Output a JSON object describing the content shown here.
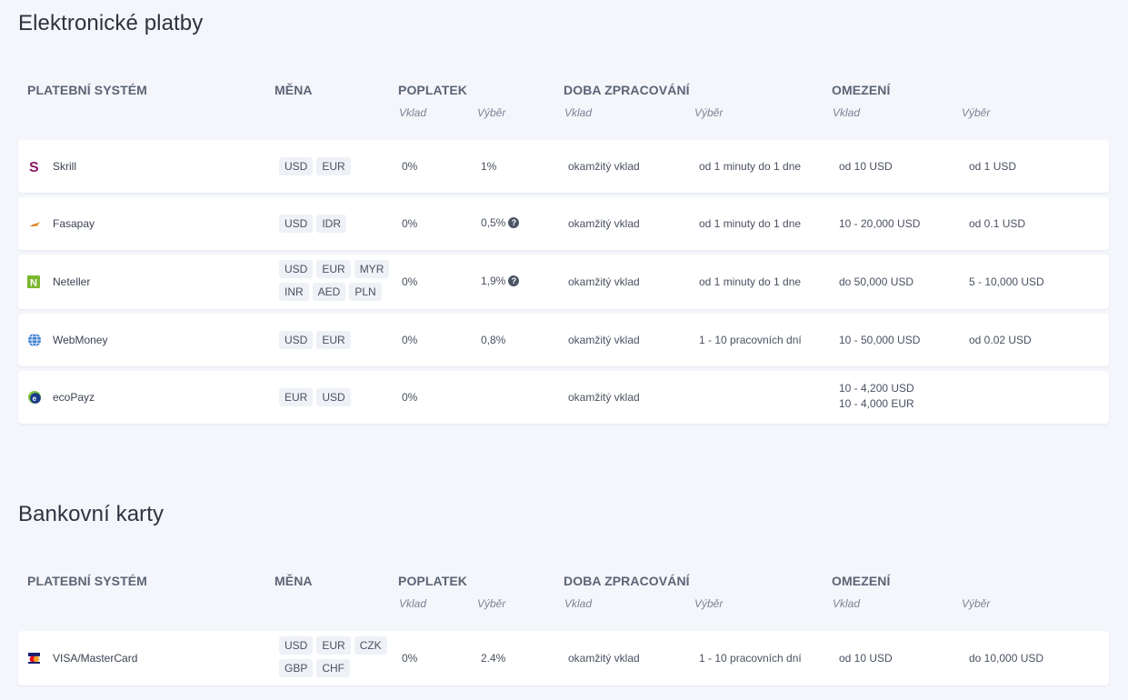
{
  "sections": [
    {
      "title": "Elektronické platby",
      "headers": {
        "system": "PLATEBNÍ SYSTÉM",
        "currency": "MĚNA",
        "fee": "POPLATEK",
        "processing": "DOBA ZPRACOVÁNÍ",
        "limits": "OMEZENÍ",
        "deposit": "Vklad",
        "withdrawal": "Výběr"
      },
      "rows": [
        {
          "name": "Skrill",
          "currencies": [
            "USD",
            "EUR"
          ],
          "fee_deposit": "0%",
          "fee_withdrawal": "1%",
          "time_deposit": "okamžitý vklad",
          "time_withdrawal": "od 1 minuty do 1 dne",
          "limit_deposit": "od 10 USD",
          "limit_withdrawal": "od 1 USD",
          "icon": "skrill-logo-icon"
        },
        {
          "name": "Fasapay",
          "currencies": [
            "USD",
            "IDR"
          ],
          "fee_deposit": "0%",
          "fee_withdrawal": "0,5%",
          "time_deposit": "okamžitý vklad",
          "time_withdrawal": "od 1 minuty do 1 dne",
          "limit_deposit": "10 - 20,000 USD",
          "limit_withdrawal": "od 0.1 USD",
          "icon": "fasapay-logo-icon"
        },
        {
          "name": "Neteller",
          "currencies": [
            "USD",
            "EUR",
            "MYR",
            "INR",
            "AED",
            "PLN"
          ],
          "fee_deposit": "0%",
          "fee_withdrawal": "1,9%",
          "time_deposit": "okamžitý vklad",
          "time_withdrawal": "od 1 minuty do 1 dne",
          "limit_deposit": "do 50,000 USD",
          "limit_withdrawal": "5 - 10,000 USD",
          "icon": "neteller-logo-icon"
        },
        {
          "name": "WebMoney",
          "currencies": [
            "USD",
            "EUR"
          ],
          "fee_deposit": "0%",
          "fee_withdrawal": "0,8%",
          "time_deposit": "okamžitý vklad",
          "time_withdrawal": "1 - 10 pracovních dní",
          "limit_deposit": "10 - 50,000 USD",
          "limit_withdrawal": "od 0.02 USD",
          "icon": "webmoney-logo-icon"
        },
        {
          "name": "ecoPayz",
          "currencies": [
            "EUR",
            "USD"
          ],
          "fee_deposit": "0%",
          "fee_withdrawal": "",
          "time_deposit": "okamžitý vklad",
          "time_withdrawal": "",
          "limit_deposit_lines": [
            "10 - 4,200 USD",
            "10 - 4,000 EUR"
          ],
          "limit_withdrawal": "",
          "icon": "ecopayz-logo-icon"
        }
      ]
    },
    {
      "title": "Bankovní karty",
      "headers": {
        "system": "PLATEBNÍ SYSTÉM",
        "currency": "MĚNA",
        "fee": "POPLATEK",
        "processing": "DOBA ZPRACOVÁNÍ",
        "limits": "OMEZENÍ",
        "deposit": "Vklad",
        "withdrawal": "Výběr"
      },
      "rows": [
        {
          "name": "VISA/MasterCard",
          "currencies": [
            "USD",
            "EUR",
            "CZK",
            "GBP",
            "CHF"
          ],
          "fee_deposit": "0%",
          "fee_withdrawal": "2.4%",
          "time_deposit": "okamžitý vklad",
          "time_withdrawal": "1 - 10 pracovních dní",
          "limit_deposit": "od 10 USD",
          "limit_withdrawal": "do 10,000 USD",
          "icon": "visa-mastercard-logo-icon"
        }
      ]
    }
  ],
  "help_icon": "question-circle-icon",
  "help_glyph": "?",
  "colors": {
    "background": "#f4f6fb",
    "row": "#ffffff",
    "tag": "#eef1f6",
    "skrill": "#8b1c64",
    "neteller": "#7cb82f",
    "webmoney": "#3b7fd1",
    "ecopayz_blue": "#1a3b8c",
    "ecopayz_green": "#7dc242"
  }
}
